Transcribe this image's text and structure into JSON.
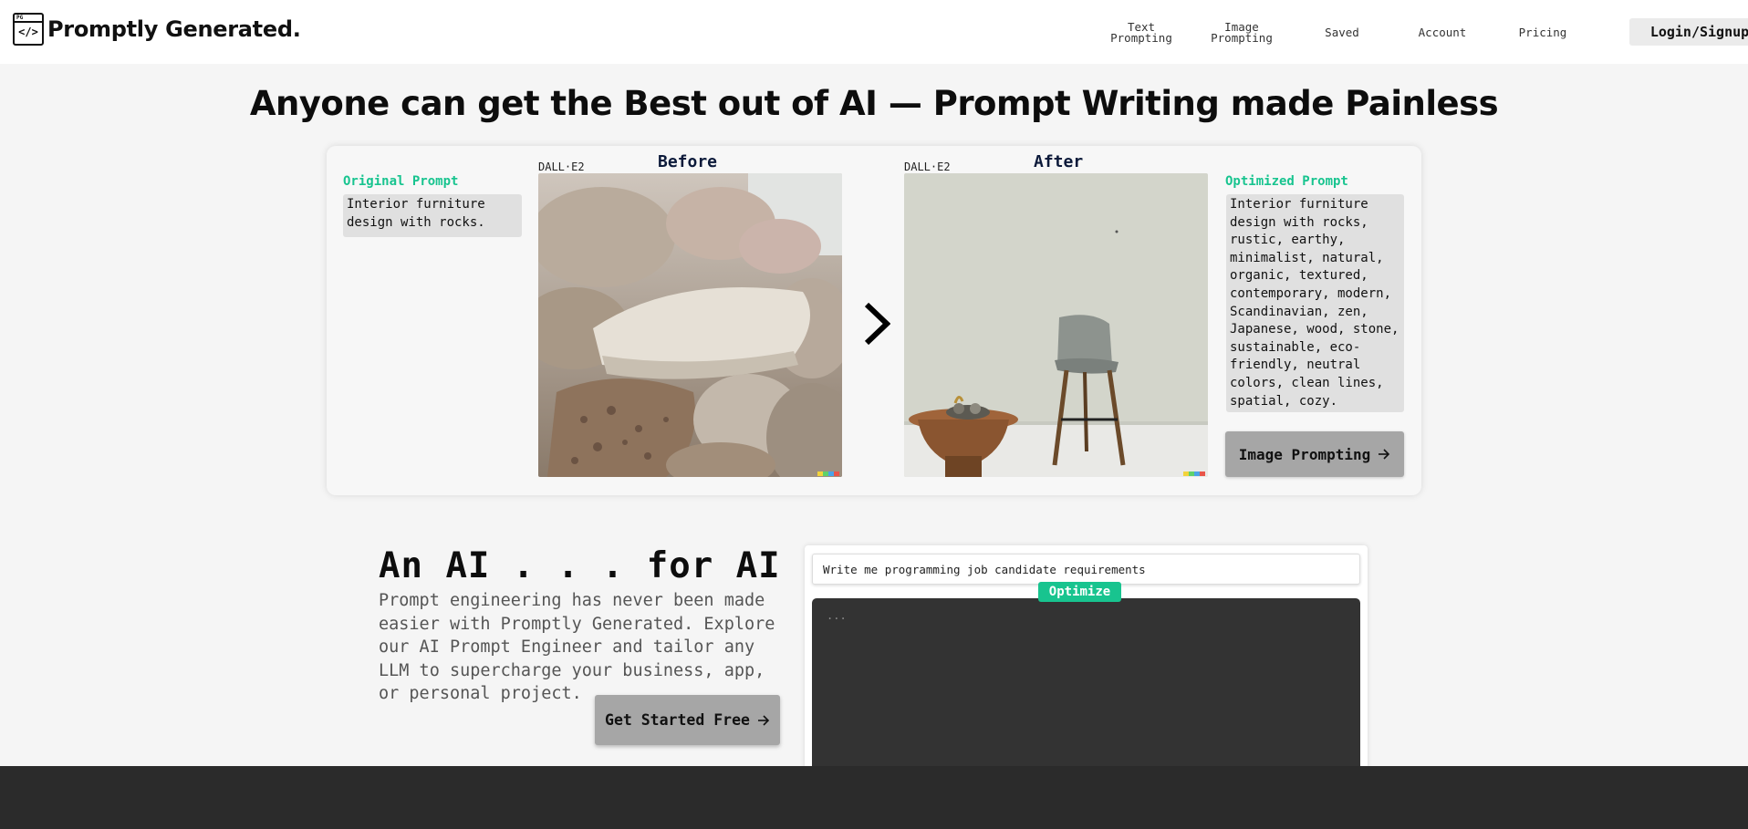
{
  "header": {
    "logo_mark_top": "PG",
    "logo_mark_code": "</>",
    "logo_text": "Promptly Generated.",
    "nav": [
      {
        "line1": "Text",
        "line2": "Prompting"
      },
      {
        "line1": "Image",
        "line2": "Prompting"
      },
      {
        "line1": "Saved",
        "line2": ""
      },
      {
        "line1": "Account",
        "line2": ""
      },
      {
        "line1": "Pricing",
        "line2": ""
      }
    ],
    "login_label": "Login/Signup"
  },
  "hero": {
    "title": "Anyone can get the Best out of AI — Prompt Writing made Painless"
  },
  "demo": {
    "original_label": "Original Prompt",
    "original_text": "Interior furniture\ndesign with rocks.",
    "before_model": "DALL·E2",
    "before_title": "Before",
    "after_model": "DALL·E2",
    "after_title": "After",
    "optimized_label": "Optimized Prompt",
    "optimized_text": "Interior furniture\ndesign with rocks,\nrustic, earthy,\nminimalist, natural,\norganic, textured,\ncontemporary, modern,\nScandinavian, zen,\nJapanese, wood, stone,\nsustainable, eco-\nfriendly, neutral\ncolors, clean lines,\nspatial, cozy.",
    "button_label": "Image Prompting",
    "button_icon": "arrow-right-icon"
  },
  "promo": {
    "title": "An AI . . . for AI",
    "description": "Prompt engineering has never been made easier with Promptly Generated. Explore our AI Prompt Engineer and tailor any LLM to supercharge your business, app, or personal project.",
    "cta_label": "Get Started Free",
    "cta_icon": "arrow-right-icon"
  },
  "optimizer": {
    "input_value": "Write me programming job candidate requirements",
    "button_label": "Optimize",
    "output_text": "...",
    "accent_color": "#18c48f"
  }
}
